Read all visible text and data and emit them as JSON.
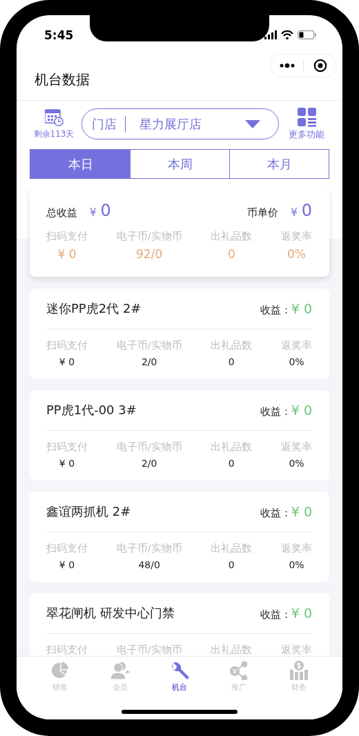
{
  "status_bar": {
    "time": "5:45"
  },
  "nav": {
    "title": "机台数据"
  },
  "toolbar": {
    "remaining": "剩余113天",
    "store_label": "门店",
    "store_name": "星力展厅店",
    "more": "更多功能"
  },
  "period_tabs": [
    {
      "label": "本日",
      "selected": true
    },
    {
      "label": "本周",
      "selected": false
    },
    {
      "label": "本月",
      "selected": false
    }
  ],
  "summary": {
    "total_label": "总收益",
    "total_currency": "¥",
    "total_value": "0",
    "price_label": "币单价",
    "price_currency": "¥",
    "price_value": "0",
    "stats": [
      {
        "label": "扫码支付",
        "value": "¥ 0"
      },
      {
        "label": "电子币/实物币",
        "value": "92/0"
      },
      {
        "label": "出礼品数",
        "value": "0"
      },
      {
        "label": "返奖率",
        "value": "0%"
      }
    ]
  },
  "machines": [
    {
      "name": "迷你PP虎2代 2#",
      "income_label": "收益：",
      "income": "¥ 0",
      "stats": [
        {
          "label": "扫码支付",
          "value": "¥ 0"
        },
        {
          "label": "电子币/实物币",
          "value": "2/0"
        },
        {
          "label": "出礼品数",
          "value": "0"
        },
        {
          "label": "返奖率",
          "value": "0%"
        }
      ]
    },
    {
      "name": "PP虎1代-00 3#",
      "income_label": "收益：",
      "income": "¥ 0",
      "stats": [
        {
          "label": "扫码支付",
          "value": "¥ 0"
        },
        {
          "label": "电子币/实物币",
          "value": "2/0"
        },
        {
          "label": "出礼品数",
          "value": "0"
        },
        {
          "label": "返奖率",
          "value": "0%"
        }
      ]
    },
    {
      "name": "鑫谊两抓机 2#",
      "income_label": "收益：",
      "income": "¥ 0",
      "stats": [
        {
          "label": "扫码支付",
          "value": "¥ 0"
        },
        {
          "label": "电子币/实物币",
          "value": "48/0"
        },
        {
          "label": "出礼品数",
          "value": "0"
        },
        {
          "label": "返奖率",
          "value": "0%"
        }
      ]
    },
    {
      "name": "翠花闸机 研发中心门禁",
      "income_label": "收益：",
      "income": "¥ 0",
      "stats": [
        {
          "label": "扫码支付"
        },
        {
          "label": "电子币/实物币"
        },
        {
          "label": "出礼品数"
        },
        {
          "label": "返奖率"
        }
      ]
    }
  ],
  "tab_bar": [
    {
      "label": "销售",
      "selected": false
    },
    {
      "label": "会员",
      "selected": false
    },
    {
      "label": "机台",
      "selected": true
    },
    {
      "label": "推广",
      "selected": false
    },
    {
      "label": "财务",
      "selected": false
    }
  ]
}
